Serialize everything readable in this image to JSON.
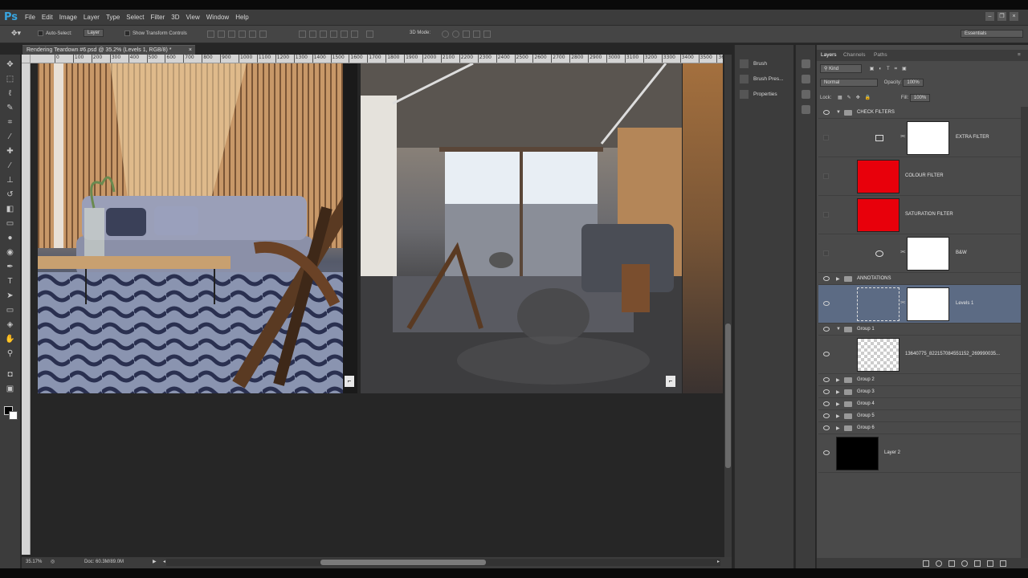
{
  "menubar": {
    "logo": "Ps",
    "items": [
      "File",
      "Edit",
      "Image",
      "Layer",
      "Type",
      "Select",
      "Filter",
      "3D",
      "View",
      "Window",
      "Help"
    ]
  },
  "options": {
    "auto_select_label": "Auto-Select:",
    "auto_select_value": "Layer",
    "show_transform_label": "Show Transform Controls",
    "mode_3d_label": "3D Mode:",
    "workspace": "Essentials"
  },
  "document": {
    "tab_title": "Rendering Teardown #6.psd @ 35.2% (Levels 1, RGB/8) *",
    "close": "×"
  },
  "ruler": {
    "ticks": [
      "0",
      "100",
      "200",
      "300",
      "400",
      "500",
      "600",
      "700",
      "800",
      "900",
      "1000",
      "1100",
      "1200",
      "1300",
      "1400",
      "1500",
      "1600",
      "1700",
      "1800",
      "1900",
      "2000",
      "2100",
      "2200",
      "2300",
      "2400",
      "2500",
      "2600",
      "2700",
      "2800",
      "2900",
      "3000",
      "3100",
      "3200",
      "3300",
      "3400",
      "3500",
      "36"
    ]
  },
  "status": {
    "zoom": "35.17%",
    "doc": "Doc: 60.3M/89.0M"
  },
  "mid_panel": {
    "items": [
      "Brush",
      "Brush Pres...",
      "Properties"
    ]
  },
  "layers_panel": {
    "tabs": [
      "Layers",
      "Channels",
      "Paths"
    ],
    "filter": "Kind",
    "blend_mode": "Normal",
    "opacity_label": "Opacity:",
    "opacity_value": "100%",
    "lock_label": "Lock:",
    "fill_label": "Fill:",
    "fill_value": "100%",
    "layers": [
      {
        "name": "CHECK FILTERS"
      },
      {
        "name": "EXTRA FILTER"
      },
      {
        "name": "COLOUR FILTER"
      },
      {
        "name": "SATURATION FILTER"
      },
      {
        "name": "B&W"
      },
      {
        "name": "ANNOTATIONS"
      },
      {
        "name": "Levels 1"
      },
      {
        "name": "Group 1"
      },
      {
        "name": "13640775_822157084551152_269990035..."
      },
      {
        "name": "Group 2"
      },
      {
        "name": "Group 3"
      },
      {
        "name": "Group 4"
      },
      {
        "name": "Group 5"
      },
      {
        "name": "Group 6"
      },
      {
        "name": "Layer 2"
      }
    ]
  },
  "colors": {
    "accent_logo": "#38a5e0",
    "selection": "#5c6b84",
    "filter_red": "#e8000b"
  }
}
